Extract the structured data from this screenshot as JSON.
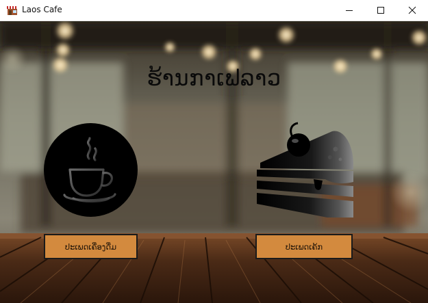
{
  "window": {
    "title": "Laos Cafe",
    "app_icon": "cafe-icon",
    "controls": [
      "minimize-icon",
      "maximize-icon",
      "close-icon"
    ]
  },
  "main": {
    "heading": "ຮ້ານກາເຟລາວ",
    "categories": [
      {
        "icon": "coffee-cup-icon",
        "label": "ປະເພດເຄື່ອງດື່ມ"
      },
      {
        "icon": "cake-slice-icon",
        "label": "ປະເພດເຄ້ກ"
      }
    ]
  },
  "colors": {
    "button": "#d38a3e",
    "button_border": "#1a1a1a",
    "heading": "#0a0a0a"
  }
}
